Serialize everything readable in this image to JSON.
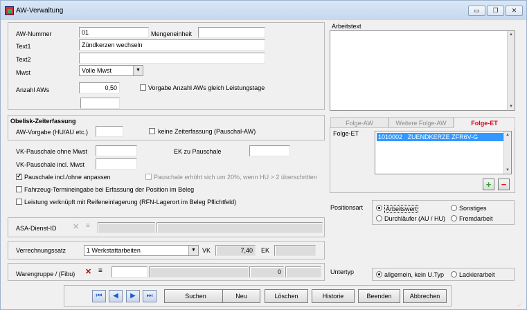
{
  "window": {
    "title": "AW-Verwaltung",
    "min": "▭",
    "max": "❐",
    "close": "✕"
  },
  "top": {
    "aw_nummer_label": "AW-Nummer",
    "aw_nummer_value": "01",
    "mengeneinheit_label": "Mengeneinheit",
    "mengeneinheit_value": "",
    "text1_label": "Text1",
    "text1_value": "Zündkerzen wechseln",
    "text2_label": "Text2",
    "text2_value": "",
    "mwst_label": "Mwst",
    "mwst_value": "Volle Mwst",
    "anzahl_label": "Anzahl AWs",
    "anzahl_value": "0,50",
    "vorgabe_label": "Vorgabe Anzahl AWs gleich Leistungstage"
  },
  "arbeitstext": {
    "label": "Arbeitstext",
    "value": ""
  },
  "obelisk": {
    "title": "Obelisk-Zeiterfassung",
    "aw_vorgabe_label": "AW-Vorgabe (HU/AU etc.)",
    "keine_label": "keine Zeiterfassung (Pauschal-AW)"
  },
  "pauschale": {
    "vk_ohne_label": "VK-Pauschale ohne Mwst",
    "ek_label": "EK zu Pauschale",
    "vk_incl_label": "VK-Pauschale incl. Mwst",
    "anpassen_label": "Pauschale incl./ohne anpassen",
    "erhoeht_label": "Pauschale erhöht sich um 20%, wenn HU > 2 überschritten",
    "fahrzeug_label": "Fahrzeug-Termineingabe bei Erfassung der Position im Beleg",
    "leistung_label": "Leistung verknüpft mit Reifeneinlagerung (RFN-Lagerort im Beleg Pflichtfeld)"
  },
  "asa": {
    "label": "ASA-Dienst-ID"
  },
  "verrechnung": {
    "label": "Verrechnungssatz",
    "value": "1 Werkstattarbeiten",
    "vk_label": "VK",
    "vk_value": "7,40",
    "ek_label": "EK"
  },
  "warengruppe": {
    "label": "Warengruppe / (Fibu)",
    "value2": "0"
  },
  "tabs": [
    "Folge-AW",
    "Weitere Folge-AW",
    "Folge-ET"
  ],
  "folge_et": {
    "label": "Folge-ET",
    "items": [
      {
        "code": "1010002",
        "name": "ZUENDKERZE ZFR6V-G"
      }
    ]
  },
  "positionsart": {
    "label": "Positionsart",
    "options": [
      "Arbeitswert",
      "Sonstiges",
      "Durchläufer (AU / HU)",
      "Fremdarbeit"
    ]
  },
  "untertyp": {
    "label": "Untertyp",
    "options": [
      "allgemein, kein U.Typ",
      "Lackierarbeit"
    ]
  },
  "footer": {
    "nav": [
      "⏮",
      "◀",
      "▶",
      "⏭"
    ],
    "buttons": [
      "Suchen",
      "Neu",
      "Löschen",
      "Historie",
      "Beenden",
      "Abbrechen"
    ]
  },
  "colors": {
    "accent": "#d8001c",
    "selection": "#3399ff",
    "add": "#2e9e2e",
    "remove": "#d01c1c"
  }
}
